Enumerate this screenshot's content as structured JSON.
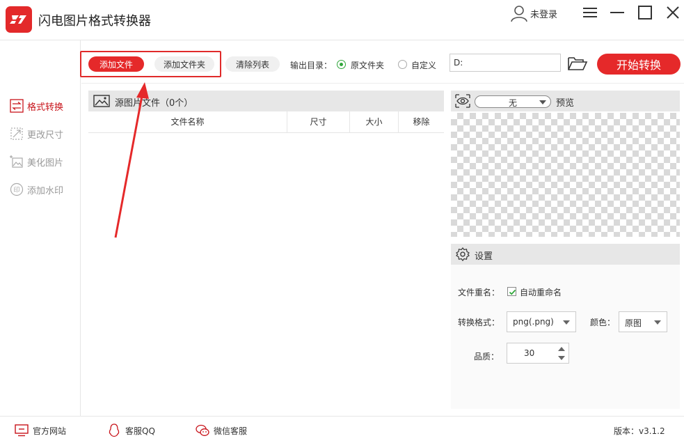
{
  "app": {
    "title": "闪电图片格式转换器",
    "user_label": "未登录"
  },
  "sidebar": {
    "items": [
      {
        "label": "格式转换",
        "icon": "swap-icon",
        "active": true
      },
      {
        "label": "更改尺寸",
        "icon": "resize-icon",
        "active": false
      },
      {
        "label": "美化图片",
        "icon": "beautify-icon",
        "active": false
      },
      {
        "label": "添加水印",
        "icon": "watermark-icon",
        "active": false
      }
    ]
  },
  "toolbar": {
    "add_file": "添加文件",
    "add_folder": "添加文件夹",
    "clear_list": "清除列表",
    "output_dir_label": "输出目录：",
    "radio_original": "原文件夹",
    "radio_custom": "自定义",
    "output_path": "D:",
    "start_button": "开始转换"
  },
  "file_panel": {
    "title": "源图片文件（0个）",
    "columns": [
      "文件名称",
      "尺寸",
      "大小",
      "移除"
    ],
    "rows": []
  },
  "preview": {
    "select_value": "无",
    "label": "预览"
  },
  "settings": {
    "title": "设置",
    "rename_label": "文件重名：",
    "auto_rename": "自动重命名",
    "auto_rename_checked": true,
    "format_label": "转换格式：",
    "format_value": "png(.png)",
    "color_label": "颜色：",
    "color_value": "原图",
    "quality_label": "品质：",
    "quality_value": "30"
  },
  "footer": {
    "official_site": "官方网站",
    "qq_service": "客服QQ",
    "wechat_service": "微信客服",
    "version": "版本：v3.1.2"
  },
  "colors": {
    "accent": "#e5292a",
    "active_sidebar": "#c8141b",
    "radio_on": "#2fa63a"
  }
}
